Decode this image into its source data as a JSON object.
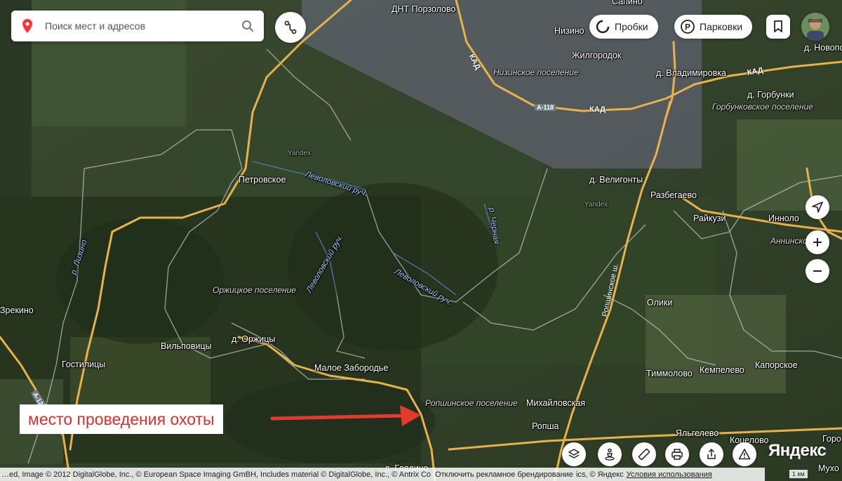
{
  "search": {
    "placeholder": "Поиск мест и адресов"
  },
  "header": {
    "traffic_label": "Пробки",
    "parking_label": "Парковки"
  },
  "annotation": {
    "text": "место проведения охоты",
    "color": "#d6302a"
  },
  "map": {
    "places": [
      {
        "id": "dnt",
        "text": "ДНТ Порзолово"
      },
      {
        "id": "sapino",
        "text": "Сапино"
      },
      {
        "id": "nizino",
        "text": "Низино"
      },
      {
        "id": "zhilgorodok",
        "text": "Жилгородок"
      },
      {
        "id": "novopolye",
        "text": "д. Новопо"
      },
      {
        "id": "vladimirovka",
        "text": "д. Владимировка"
      },
      {
        "id": "gorbunki",
        "text": "д. Горбунки"
      },
      {
        "id": "petrovskoe",
        "text": "Петровское"
      },
      {
        "id": "veligonty",
        "text": "д. Велигонты"
      },
      {
        "id": "razbegaevo",
        "text": "Разбегаево"
      },
      {
        "id": "raykuzi",
        "text": "Райкузи"
      },
      {
        "id": "innolovo",
        "text": "Инноло"
      },
      {
        "id": "oliki",
        "text": "Олики"
      },
      {
        "id": "zrekino",
        "text": "Зрекино"
      },
      {
        "id": "vilpovitsy",
        "text": "Вильповицы"
      },
      {
        "id": "orzhitsy",
        "text": "д. Оржицы"
      },
      {
        "id": "gostilitsy",
        "text": "Гостилицы"
      },
      {
        "id": "maloe",
        "text": "Малое Забородье"
      },
      {
        "id": "timmolovo",
        "text": "Тиммолово"
      },
      {
        "id": "kempelevo",
        "text": "Кемпелево"
      },
      {
        "id": "kaporskoe",
        "text": "Капорское"
      },
      {
        "id": "mikhaylovskaya",
        "text": "Михайловская"
      },
      {
        "id": "ropsha",
        "text": "Ропша"
      },
      {
        "id": "yalgelevo",
        "text": "Яльгелево"
      },
      {
        "id": "kotselovo",
        "text": "Коцелово"
      },
      {
        "id": "gor",
        "text": "Горо"
      },
      {
        "id": "glyadino",
        "text": "д. Глядино"
      },
      {
        "id": "mukho",
        "text": "Мухо"
      }
    ],
    "areas": [
      {
        "id": "nizinskoe",
        "text": "Низинское поселение"
      },
      {
        "id": "gorbunkovskoe",
        "text": "Горбунковское поселение"
      },
      {
        "id": "anninskoe",
        "text": "Аннинское по"
      },
      {
        "id": "orzhitskoe",
        "text": "Оржицкое поселение"
      },
      {
        "id": "ropshinskoe",
        "text": "Ропшинское поселение"
      }
    ],
    "rivers": [
      {
        "id": "levolovsky1",
        "text": "Леволовский руч."
      },
      {
        "id": "levolovsky2",
        "text": "Леволовский руч."
      },
      {
        "id": "levolovsky3",
        "text": "Леволовский руч."
      },
      {
        "id": "chernaya",
        "text": "р. Черная"
      },
      {
        "id": "lizino",
        "text": "р. Лизино"
      }
    ],
    "roads": [
      {
        "id": "kad1",
        "text": "КАД"
      },
      {
        "id": "kad2",
        "text": "КАД"
      },
      {
        "id": "kad3",
        "text": "КАД"
      },
      {
        "id": "ropshinskoe_sh",
        "text": "Ропшинское ш."
      },
      {
        "id": "a118",
        "text": "А-118"
      },
      {
        "id": "a120",
        "text": "А-120"
      }
    ],
    "watermarks": [
      "Yandex",
      "Yandex"
    ]
  },
  "footer": {
    "copyright": "…ed, Image © 2012 DigitalGlobe, Inc., © European Space Imaging GmBH, Includes material © DigitalGlobe, Inc., © Antrix Co",
    "ad_off": "Отключить рекламное брендирование",
    "tail": "ics, © Яндекс",
    "terms": "Условия использования"
  },
  "logo": "Яндекс",
  "scale_label": "1 км",
  "colors": {
    "road": "#e8b14a",
    "annotation": "#d6302a",
    "river": "#9ec9ff"
  }
}
